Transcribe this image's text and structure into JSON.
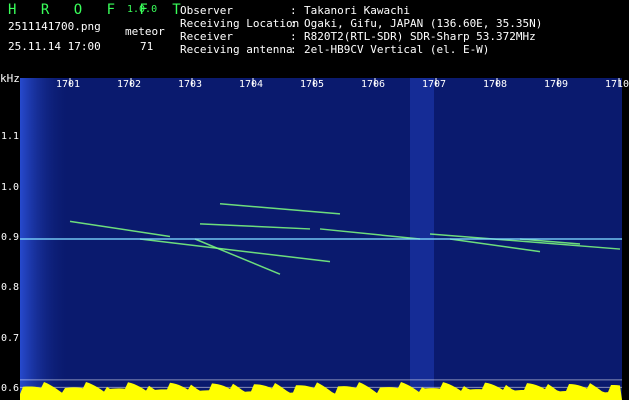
{
  "header": {
    "title": "H R O F F T",
    "version": "1.0.0",
    "file_name": "2511141700.png",
    "date_time": "25.11.14 17:00",
    "meteor_label": "meteor",
    "meteor_count": "71"
  },
  "info": {
    "rows": [
      {
        "label": "Observer",
        "value": "Takanori Kawachi"
      },
      {
        "label": "Receiving Location",
        "value": "Ogaki, Gifu, JAPAN (136.60E, 35.35N)"
      },
      {
        "label": "Receiver",
        "value": "R820T2(RTL-SDR) SDR-Sharp 53.372MHz"
      },
      {
        "label": "Receiving antenna",
        "value": "2el-HB9CV Vertical (el. E-W)"
      }
    ],
    "separator": ":"
  },
  "chart_data": {
    "type": "heatmap",
    "ylabel": "kHz",
    "y_ticks": [
      "1.1",
      "1.0",
      "0.9",
      "0.8",
      "0.7",
      "0.6"
    ],
    "x_ticks": [
      "1701",
      "1702",
      "1703",
      "1704",
      "1705",
      "1706",
      "1707",
      "1708",
      "1709",
      "1710"
    ],
    "ylim": [
      0.58,
      1.22
    ],
    "background_color": "#0a1a6e",
    "colors": {
      "text": "#ffffff",
      "title": "#39ff5a",
      "baseline": "#ffff00",
      "trail": "#7fff7f"
    }
  }
}
